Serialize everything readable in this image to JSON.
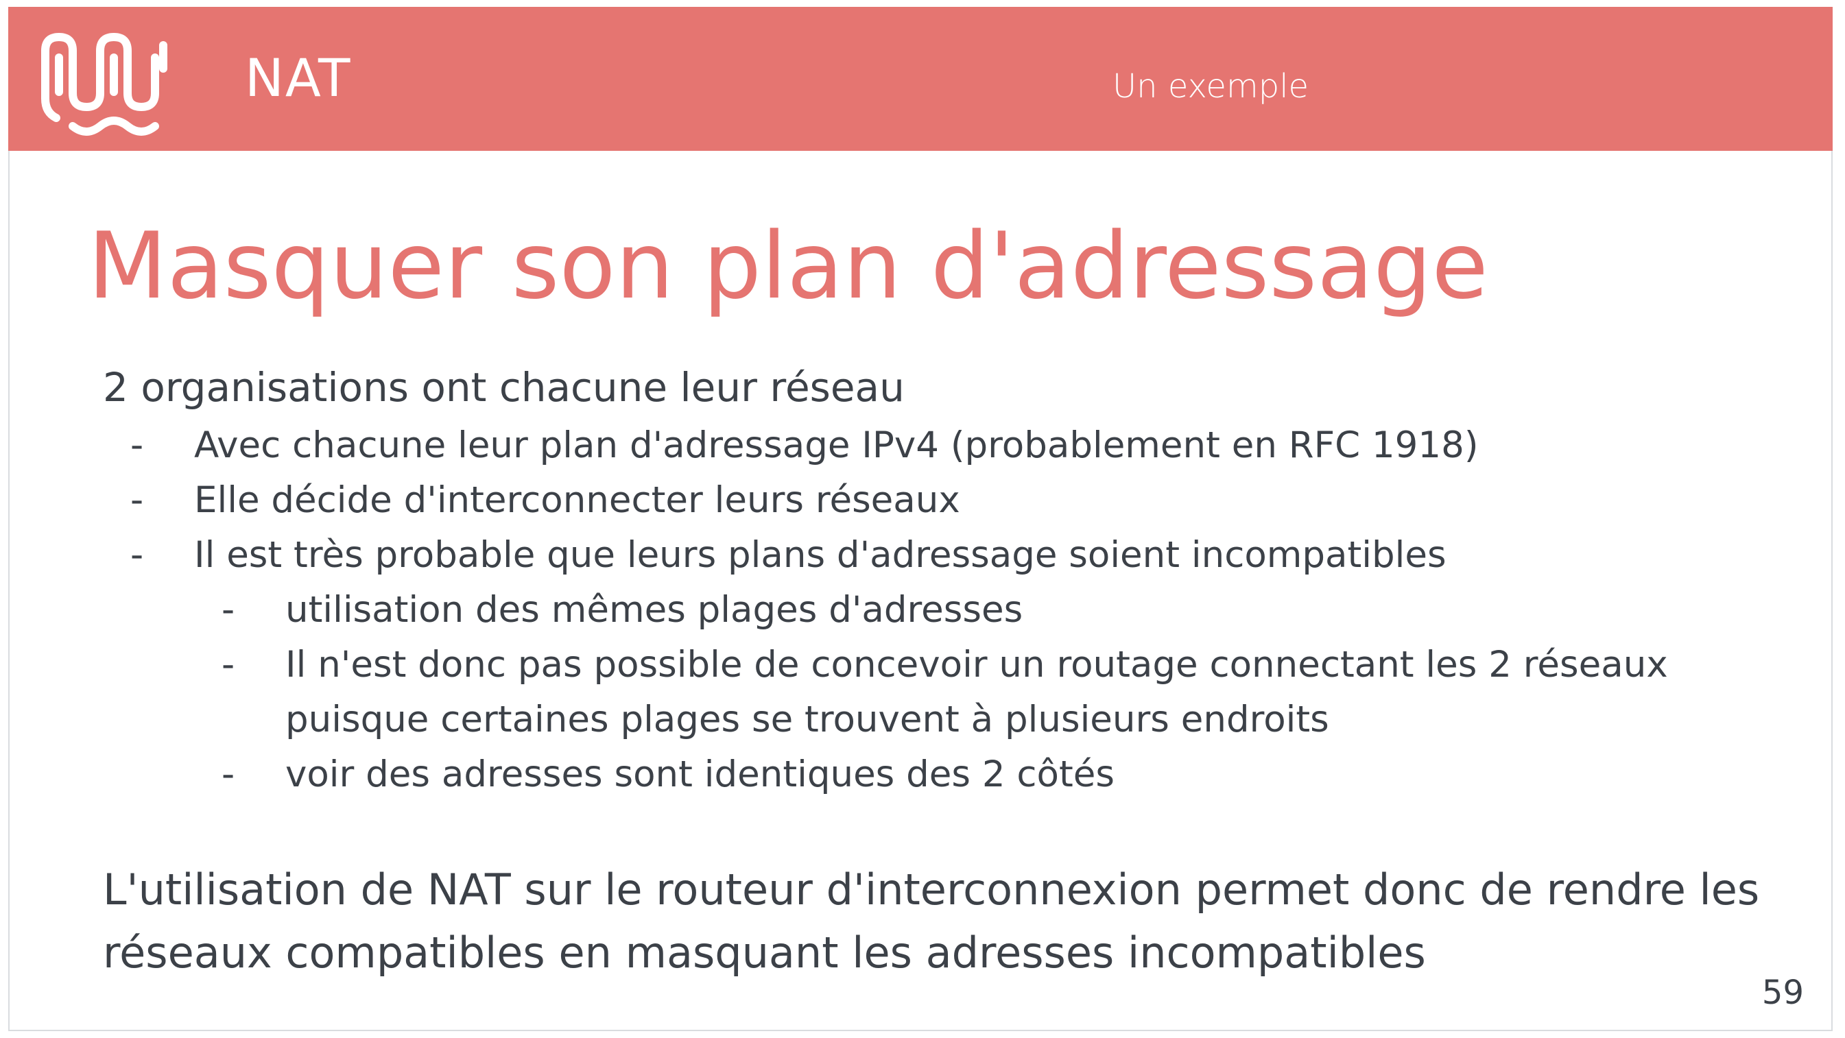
{
  "header": {
    "section": "NAT",
    "subtitle": "Un exemple",
    "background_color": "#e57571",
    "logo_icon": "wave-logo-icon"
  },
  "title": "Masquer son plan d'adressage",
  "body": {
    "intro": "2 organisations ont chacune leur réseau",
    "bullets": [
      "Avec chacune leur plan d'adressage IPv4 (probablement en RFC 1918)",
      "Elle décide d'interconnecter leurs réseaux",
      "Il est très probable que leurs plans d'adressage soient incompatibles"
    ],
    "sub_bullets": [
      "utilisation des mêmes plages d'adresses",
      "Il n'est donc pas possible de concevoir un routage connectant les 2 réseaux",
      "puisque certaines plages se trouvent à plusieurs endroits",
      "voir des adresses sont identiques des 2 côtés"
    ],
    "dash": "-",
    "conclusion_line1": "L'utilisation de NAT sur le routeur d'interconnexion permet donc de rendre les",
    "conclusion_line2": "réseaux compatibles en masquant les adresses incompatibles"
  },
  "page_number": "59",
  "colors": {
    "accent": "#e57571",
    "text": "#3c4148"
  }
}
